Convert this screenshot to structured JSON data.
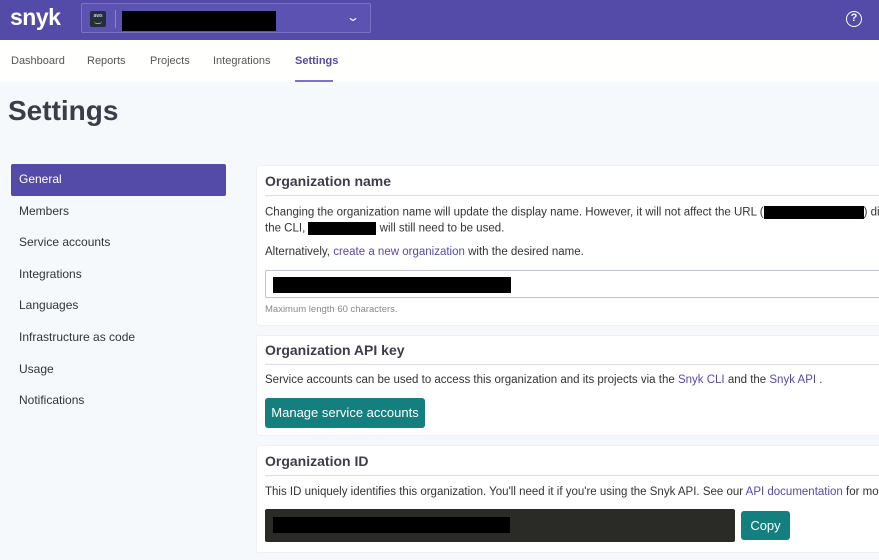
{
  "app": {
    "logo_text": "snyk"
  },
  "topbar": {
    "org_selector": {
      "integration_icon": "aws-icon",
      "value": "[redacted]"
    },
    "help_icon": "question-circle-icon",
    "help_glyph": "?",
    "chevron_glyph": "⌄"
  },
  "nav": {
    "tabs": [
      {
        "label": "Dashboard",
        "active": false
      },
      {
        "label": "Reports",
        "active": false
      },
      {
        "label": "Projects",
        "active": false
      },
      {
        "label": "Integrations",
        "active": false
      },
      {
        "label": "Settings",
        "active": true
      }
    ]
  },
  "page": {
    "title": "Settings"
  },
  "sidebar": {
    "items": [
      {
        "label": "General",
        "active": true
      },
      {
        "label": "Members",
        "active": false
      },
      {
        "label": "Service accounts",
        "active": false
      },
      {
        "label": "Integrations",
        "active": false
      },
      {
        "label": "Languages",
        "active": false
      },
      {
        "label": "Infrastructure as code",
        "active": false
      },
      {
        "label": "Usage",
        "active": false
      },
      {
        "label": "Notifications",
        "active": false
      }
    ]
  },
  "org_name_card": {
    "title": "Organization name",
    "desc_part1": "Changing the organization name will update the display name. However, it will not affect the URL (",
    "desc_part2": ") disp",
    "desc_line2_part1": "the CLI, ",
    "desc_line2_part2": " will still need to be used.",
    "alt_prefix": "Alternatively, ",
    "alt_link": "create a new organization",
    "alt_suffix": " with the desired name.",
    "input_value": "[redacted]",
    "helper": "Maximum length 60 characters."
  },
  "api_key_card": {
    "title": "Organization API key",
    "desc_prefix": "Service accounts can be used to access this organization and its projects via the ",
    "link_cli": "Snyk CLI",
    "desc_mid": " and the ",
    "link_api": "Snyk API",
    "desc_suffix": " .",
    "button": "Manage service accounts"
  },
  "org_id_card": {
    "title": "Organization ID",
    "desc_prefix": "This ID uniquely identifies this organization. You'll need it if you're using the Snyk API. See our ",
    "link": "API documentation",
    "desc_suffix": " for more d",
    "id_value": "[redacted]",
    "copy_button": "Copy"
  },
  "colors": {
    "brand": "#544ba8",
    "teal": "#137f7e",
    "link": "#544ba8"
  }
}
